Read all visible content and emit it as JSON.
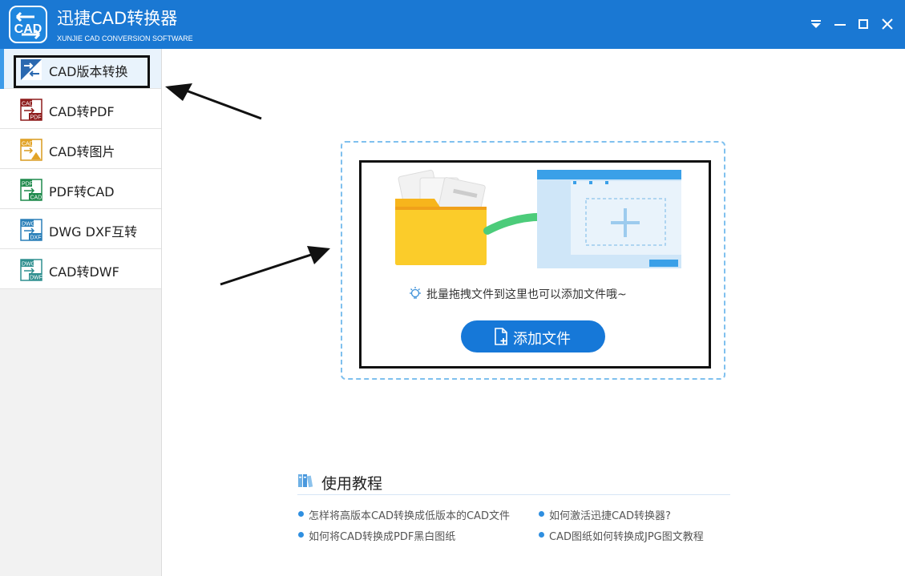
{
  "app": {
    "title": "迅捷CAD转换器",
    "subtitle": "XUNJIE CAD CONVERSION SOFTWARE",
    "logo_text": "CAD",
    "accent_color": "#1a78d3"
  },
  "window_controls": {
    "icons": [
      "dropdown-menu-icon",
      "minimize-icon",
      "maximize-icon",
      "close-icon"
    ]
  },
  "sidebar": {
    "items": [
      {
        "label": "CAD版本转换",
        "icon": "cad-version-convert-icon",
        "active": true
      },
      {
        "label": "CAD转PDF",
        "icon": "cad-to-pdf-icon",
        "active": false
      },
      {
        "label": "CAD转图片",
        "icon": "cad-to-image-icon",
        "active": false
      },
      {
        "label": "PDF转CAD",
        "icon": "pdf-to-cad-icon",
        "active": false
      },
      {
        "label": "DWG DXF互转",
        "icon": "dwg-dxf-convert-icon",
        "active": false
      },
      {
        "label": "CAD转DWF",
        "icon": "cad-to-dwf-icon",
        "active": false
      }
    ]
  },
  "dropzone": {
    "hint": "批量拖拽文件到这里也可以添加文件哦~",
    "add_button": "添加文件"
  },
  "tutorial": {
    "title": "使用教程",
    "links": [
      "怎样将高版本CAD转换成低版本的CAD文件",
      "如何激活迅捷CAD转换器?",
      "如何将CAD转换成PDF黑白图纸",
      "CAD图纸如何转换成JPG图文教程"
    ]
  }
}
